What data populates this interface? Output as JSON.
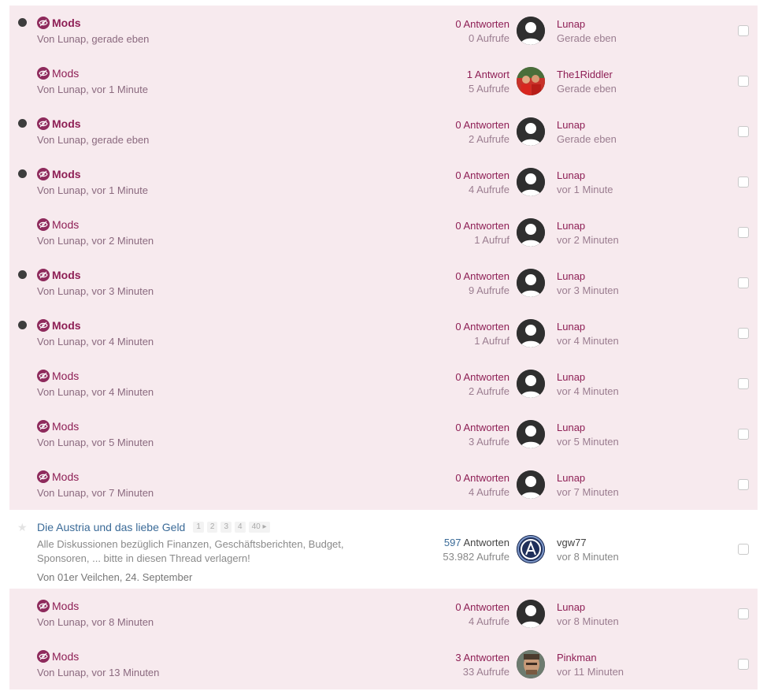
{
  "rows": [
    {
      "type": "hidden",
      "unread": true,
      "title": "Mods",
      "meta": "Von Lunap, gerade eben",
      "replies": "0 Antworten",
      "views": "0 Aufrufe",
      "user": "Lunap",
      "time": "Gerade eben",
      "avatar": "default"
    },
    {
      "type": "hidden",
      "unread": false,
      "title": "Mods",
      "meta": "Von Lunap, vor 1 Minute",
      "replies": "1 Antwort",
      "views": "5 Aufrufe",
      "user": "The1Riddler",
      "time": "Gerade eben",
      "avatar": "photo-red"
    },
    {
      "type": "hidden",
      "unread": true,
      "title": "Mods",
      "meta": "Von Lunap, gerade eben",
      "replies": "0 Antworten",
      "views": "2 Aufrufe",
      "user": "Lunap",
      "time": "Gerade eben",
      "avatar": "default"
    },
    {
      "type": "hidden",
      "unread": true,
      "title": "Mods",
      "meta": "Von Lunap, vor 1 Minute",
      "replies": "0 Antworten",
      "views": "4 Aufrufe",
      "user": "Lunap",
      "time": "vor 1 Minute",
      "avatar": "default"
    },
    {
      "type": "hidden",
      "unread": false,
      "title": "Mods",
      "meta": "Von Lunap, vor 2 Minuten",
      "replies": "0 Antworten",
      "views": "1 Aufruf",
      "user": "Lunap",
      "time": "vor 2 Minuten",
      "avatar": "default"
    },
    {
      "type": "hidden",
      "unread": true,
      "title": "Mods",
      "meta": "Von Lunap, vor 3 Minuten",
      "replies": "0 Antworten",
      "views": "9 Aufrufe",
      "user": "Lunap",
      "time": "vor 3 Minuten",
      "avatar": "default"
    },
    {
      "type": "hidden",
      "unread": true,
      "title": "Mods",
      "meta": "Von Lunap, vor 4 Minuten",
      "replies": "0 Antworten",
      "views": "1 Aufruf",
      "user": "Lunap",
      "time": "vor 4 Minuten",
      "avatar": "default"
    },
    {
      "type": "hidden",
      "unread": false,
      "title": "Mods",
      "meta": "Von Lunap, vor 4 Minuten",
      "replies": "0 Antworten",
      "views": "2 Aufrufe",
      "user": "Lunap",
      "time": "vor 4 Minuten",
      "avatar": "default"
    },
    {
      "type": "hidden",
      "unread": false,
      "title": "Mods",
      "meta": "Von Lunap, vor 5 Minuten",
      "replies": "0 Antworten",
      "views": "3 Aufrufe",
      "user": "Lunap",
      "time": "vor 5 Minuten",
      "avatar": "default"
    },
    {
      "type": "hidden",
      "unread": false,
      "title": "Mods",
      "meta": "Von Lunap, vor 7 Minuten",
      "replies": "0 Antworten",
      "views": "4 Aufrufe",
      "user": "Lunap",
      "time": "vor 7 Minuten",
      "avatar": "default"
    },
    {
      "type": "normal",
      "unread": false,
      "title": "Die Austria und das liebe Geld",
      "pages": [
        "1",
        "2",
        "3",
        "4",
        "40"
      ],
      "description": "Alle Diskussionen bezüglich Finanzen, Geschäftsberichten, Budget, Sponsoren, ... bitte in diesen Thread verlagern!",
      "meta": "Von 01er Veilchen, 24. September",
      "replies_num": "597",
      "replies_label": "Antworten",
      "views": "53.982 Aufrufe",
      "user": "vgw77",
      "time": "vor 8 Minuten",
      "avatar": "logo"
    },
    {
      "type": "hidden",
      "unread": false,
      "title": "Mods",
      "meta": "Von Lunap, vor 8 Minuten",
      "replies": "0 Antworten",
      "views": "4 Aufrufe",
      "user": "Lunap",
      "time": "vor 8 Minuten",
      "avatar": "default"
    },
    {
      "type": "hidden",
      "unread": false,
      "title": "Mods",
      "meta": "Von Lunap, vor 13 Minuten",
      "replies": "3 Antworten",
      "views": "33 Aufrufe",
      "user": "Pinkman",
      "time": "vor 11 Minuten",
      "avatar": "photo-face"
    }
  ]
}
